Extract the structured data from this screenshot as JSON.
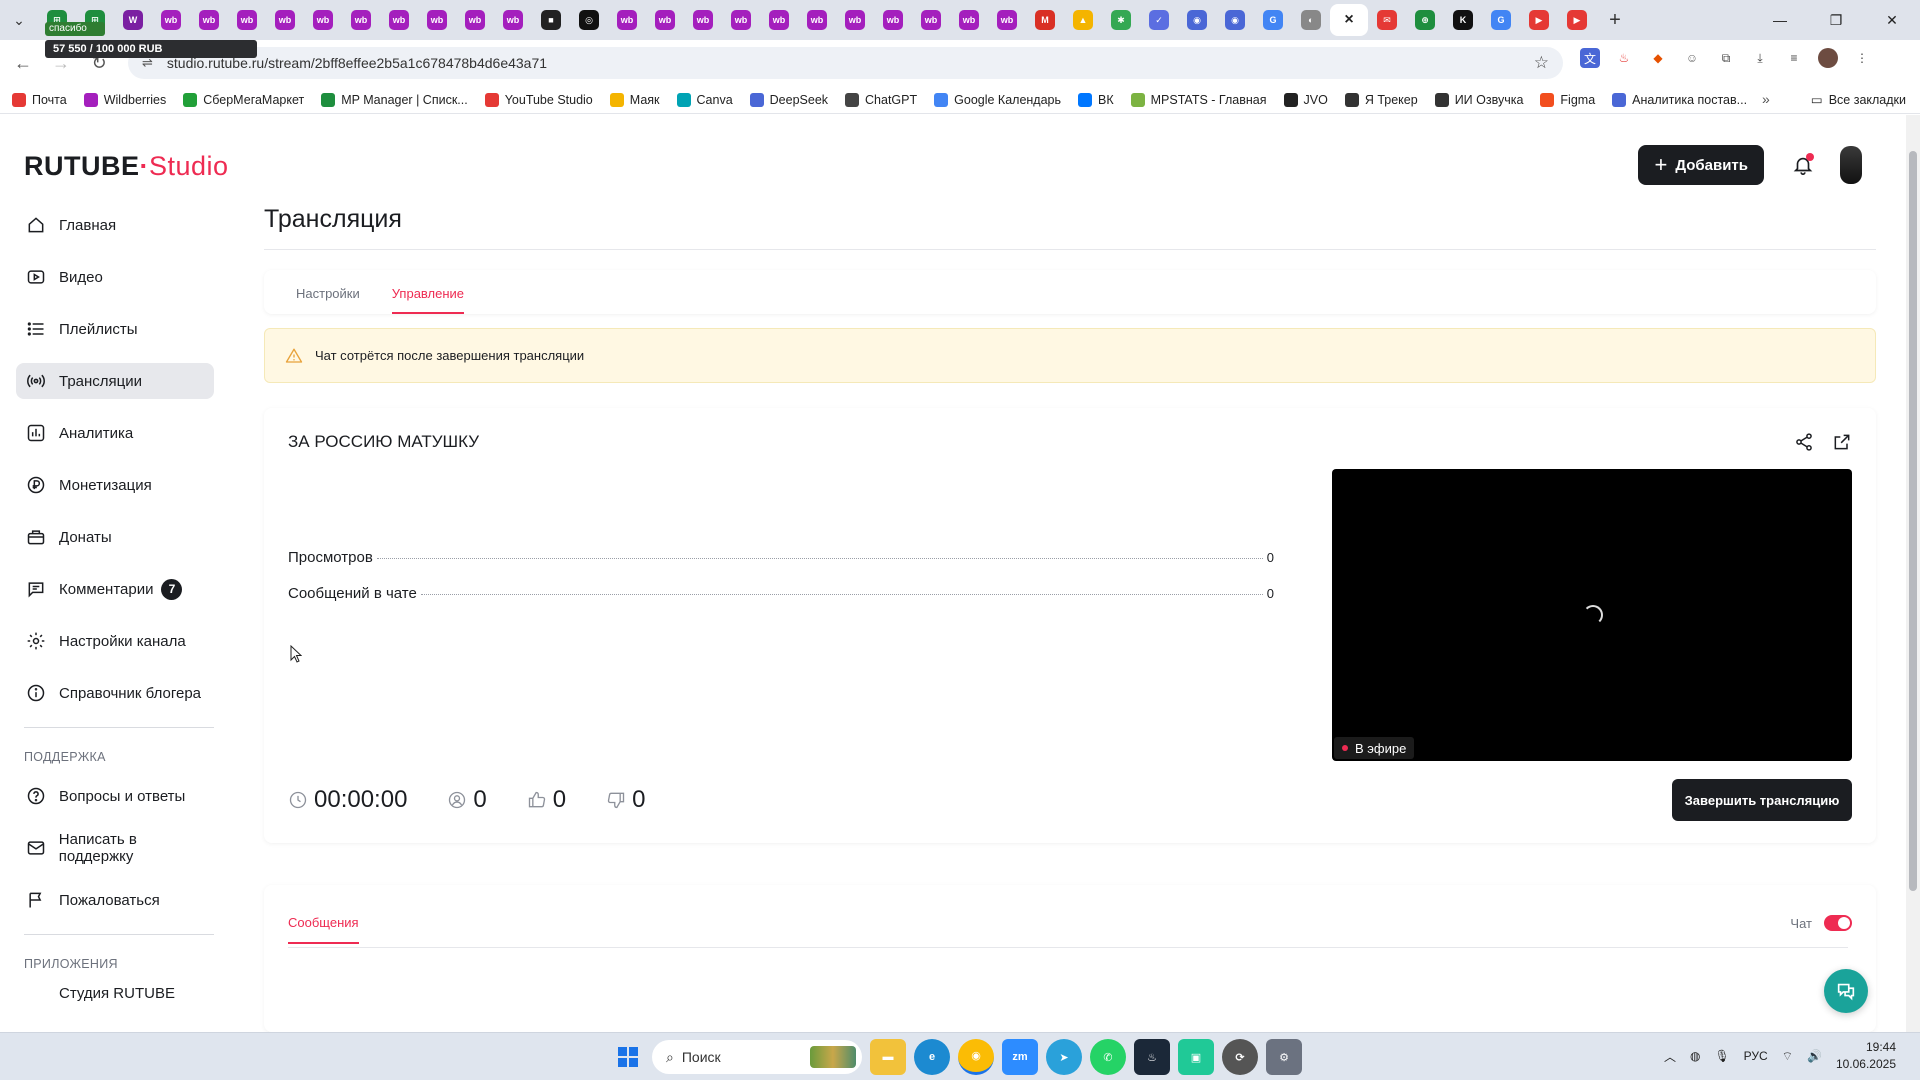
{
  "browser": {
    "promo_text": "57 550 / 100 000 RUB",
    "promo_tag": "спасибо",
    "url": "studio.rutube.ru/stream/2bff8effee2b5a1c678478b4d6e43a71",
    "tab_favicons": [
      {
        "label": "⊞",
        "color": "#1e8e3e"
      },
      {
        "label": "⊞",
        "color": "#1e8e3e"
      },
      {
        "label": "W",
        "color": "#7b1fa2"
      },
      {
        "label": "wb",
        "color": "#a41fbd"
      },
      {
        "label": "wb",
        "color": "#a41fbd"
      },
      {
        "label": "wb",
        "color": "#a41fbd"
      },
      {
        "label": "wb",
        "color": "#a41fbd"
      },
      {
        "label": "wb",
        "color": "#a41fbd"
      },
      {
        "label": "wb",
        "color": "#a41fbd"
      },
      {
        "label": "wb",
        "color": "#a41fbd"
      },
      {
        "label": "wb",
        "color": "#a41fbd"
      },
      {
        "label": "wb",
        "color": "#a41fbd"
      },
      {
        "label": "wb",
        "color": "#a41fbd"
      },
      {
        "label": "■",
        "color": "#222222"
      },
      {
        "label": "◎",
        "color": "#111111"
      },
      {
        "label": "wb",
        "color": "#a41fbd"
      },
      {
        "label": "wb",
        "color": "#a41fbd"
      },
      {
        "label": "wb",
        "color": "#a41fbd"
      },
      {
        "label": "wb",
        "color": "#a41fbd"
      },
      {
        "label": "wb",
        "color": "#a41fbd"
      },
      {
        "label": "wb",
        "color": "#a41fbd"
      },
      {
        "label": "wb",
        "color": "#a41fbd"
      },
      {
        "label": "wb",
        "color": "#a41fbd"
      },
      {
        "label": "wb",
        "color": "#a41fbd"
      },
      {
        "label": "wb",
        "color": "#a41fbd"
      },
      {
        "label": "wb",
        "color": "#a41fbd"
      },
      {
        "label": "M",
        "color": "#d93025"
      },
      {
        "label": "▲",
        "color": "#f4b400"
      },
      {
        "label": "✱",
        "color": "#34a853"
      },
      {
        "label": "✓",
        "color": "#5b6ee1"
      },
      {
        "label": "◉",
        "color": "#4a67d6"
      },
      {
        "label": "◉",
        "color": "#4a67d6"
      },
      {
        "label": "G",
        "color": "#4285f4"
      },
      {
        "label": "◐",
        "color": "#888888"
      },
      {
        "label": "×",
        "color": "#ffffff"
      },
      {
        "label": "✉",
        "color": "#e53935"
      },
      {
        "label": "⊕",
        "color": "#1e8e3e"
      },
      {
        "label": "K",
        "color": "#111111"
      },
      {
        "label": "G",
        "color": "#4285f4"
      },
      {
        "label": "▶",
        "color": "#e53935"
      },
      {
        "label": "▶",
        "color": "#e53935"
      }
    ],
    "bookmarks": [
      {
        "label": "Почта",
        "color": "#e53935",
        "icon": "mail-icon"
      },
      {
        "label": "Wildberries",
        "color": "#a41fbd",
        "icon": "wildberries-icon"
      },
      {
        "label": "СберМегаМаркет",
        "color": "#21a038",
        "icon": "sber-icon"
      },
      {
        "label": "MP Manager | Списк...",
        "color": "#1e8e3e",
        "icon": "mpmanager-icon"
      },
      {
        "label": "YouTube Studio",
        "color": "#e53935",
        "icon": "youtube-icon"
      },
      {
        "label": "Маяк",
        "color": "#f4b400",
        "icon": "mayak-icon"
      },
      {
        "label": "Canva",
        "color": "#00a3b4",
        "icon": "canva-icon"
      },
      {
        "label": "DeepSeek",
        "color": "#4a67d6",
        "icon": "deepseek-icon"
      },
      {
        "label": "ChatGPT",
        "color": "#444444",
        "icon": "chatgpt-icon"
      },
      {
        "label": "Google Календарь",
        "color": "#4285f4",
        "icon": "calendar-icon"
      },
      {
        "label": "ВК",
        "color": "#0077ff",
        "icon": "vk-icon"
      },
      {
        "label": "MPSTATS - Главная",
        "color": "#7cb342",
        "icon": "mpstats-icon"
      },
      {
        "label": "JVO",
        "color": "#222222",
        "icon": "jvo-icon"
      },
      {
        "label": "Я Трекер",
        "color": "#333333",
        "icon": "tracker-icon"
      },
      {
        "label": "ИИ Озвучка",
        "color": "#333333",
        "icon": "voice-icon"
      },
      {
        "label": "Figma",
        "color": "#f24e1e",
        "icon": "figma-icon"
      },
      {
        "label": "Аналитика постав...",
        "color": "#4a67d6",
        "icon": "analytics-icon"
      }
    ],
    "all_bookmarks": "Все закладки"
  },
  "app": {
    "logo_main": "RUTUBE",
    "logo_dot": "·",
    "logo_studio": "Studio",
    "add_button": "Добавить"
  },
  "sidebar": {
    "items": [
      {
        "label": "Главная",
        "icon": "home-icon"
      },
      {
        "label": "Видео",
        "icon": "video-icon"
      },
      {
        "label": "Плейлисты",
        "icon": "playlist-icon"
      },
      {
        "label": "Трансляции",
        "icon": "broadcast-icon",
        "active": true
      },
      {
        "label": "Аналитика",
        "icon": "analytics-icon"
      },
      {
        "label": "Монетизация",
        "icon": "ruble-icon"
      },
      {
        "label": "Донаты",
        "icon": "donate-icon"
      },
      {
        "label": "Комментарии",
        "icon": "comment-icon",
        "badge": "7"
      },
      {
        "label": "Настройки канала",
        "icon": "settings-icon"
      },
      {
        "label": "Справочник блогера",
        "icon": "info-icon"
      }
    ],
    "support_title": "ПОДДЕРЖКА",
    "support_items": [
      {
        "label": "Вопросы и ответы",
        "icon": "question-icon"
      },
      {
        "label": "Написать в поддержку",
        "icon": "mail-icon"
      },
      {
        "label": "Пожаловаться",
        "icon": "flag-icon"
      }
    ],
    "apps_title": "ПРИЛОЖЕНИЯ",
    "apps_partial": "Студия RUTUBE"
  },
  "main": {
    "title": "Трансляция",
    "tabs": [
      {
        "label": "Настройки",
        "active": false
      },
      {
        "label": "Управление",
        "active": true
      }
    ],
    "alert": "Чат сотрётся после завершения трансляции",
    "stream": {
      "title": "ЗА РОССИЮ МАТУШКУ",
      "stats": [
        {
          "label": "Просмотров",
          "value": "0"
        },
        {
          "label": "Сообщений в чате",
          "value": "0"
        }
      ],
      "live_label": "В эфире",
      "timer": "00:00:00",
      "viewers": "0",
      "likes": "0",
      "dislikes": "0",
      "end_button": "Завершить трансляцию"
    },
    "messages_tab": "Сообщения",
    "chat_label": "Чат",
    "chat_enabled": true
  },
  "taskbar": {
    "search": "Поиск",
    "lang": "РУС",
    "time": "19:44",
    "date": "10.06.2025"
  },
  "colors": {
    "accent": "#ee2b52",
    "dark": "#1b1d21",
    "alert_bg": "#fff8e3",
    "fab": "#1aa39a"
  }
}
